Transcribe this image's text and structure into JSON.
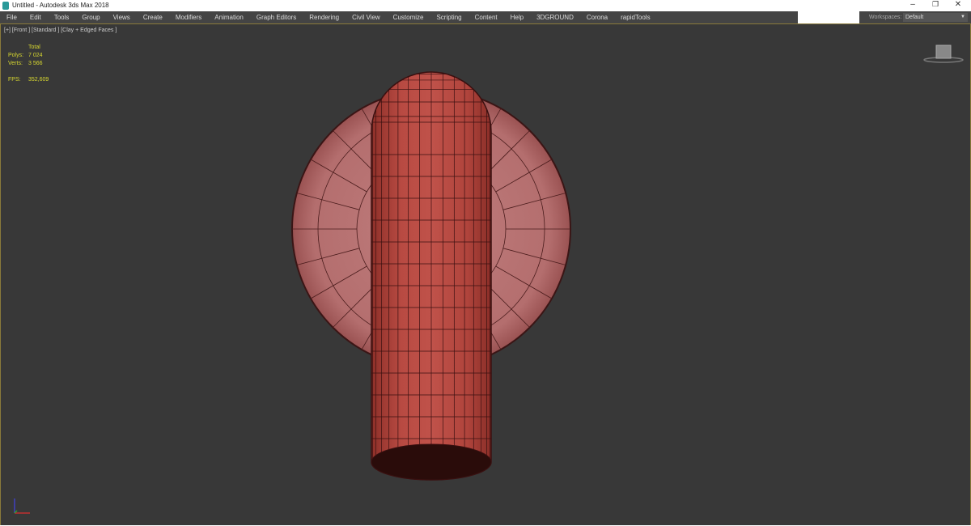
{
  "window": {
    "title": "Untitled - Autodesk 3ds Max 2018",
    "controls": [
      "minimize",
      "restore",
      "close"
    ]
  },
  "menu": [
    "File",
    "Edit",
    "Tools",
    "Group",
    "Views",
    "Create",
    "Modifiers",
    "Animation",
    "Graph Editors",
    "Rendering",
    "Civil View",
    "Customize",
    "Scripting",
    "Content",
    "Help",
    "3DGROUND",
    "Corona",
    "rapidTools"
  ],
  "workspaces": {
    "label": "Workspaces:",
    "value": "Default"
  },
  "viewport": {
    "label": "[+] [Front ] [Standard ] [Clay + Edged Faces ]",
    "stats": {
      "header": "Total",
      "polys_label": "Polys:",
      "polys": "7 024",
      "verts_label": "Verts:",
      "verts": "3 566",
      "fps_label": "FPS:",
      "fps": "352,609"
    }
  },
  "colors": {
    "accent_border": "#8a7a3a",
    "stats_text": "#d8d830",
    "disc": "#b87474",
    "cylinder": "#b0463e"
  }
}
